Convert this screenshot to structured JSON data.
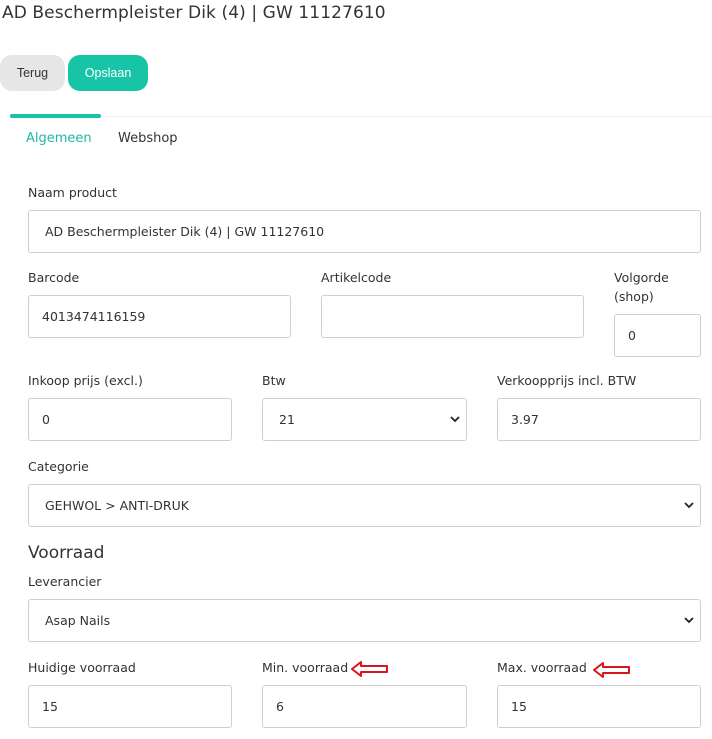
{
  "title": "AD Beschermpleister Dik (4) | GW 11127610",
  "buttons": {
    "back": "Terug",
    "save": "Opslaan"
  },
  "tabs": {
    "general": "Algemeen",
    "webshop": "Webshop"
  },
  "product": {
    "name_label": "Naam product",
    "name_value": "AD Beschermpleister Dik (4) | GW 11127610",
    "barcode_label": "Barcode",
    "barcode_value": "4013474116159",
    "article_label": "Artikelcode",
    "article_value": "",
    "order_label_1": "Volgorde",
    "order_label_2": "(shop)",
    "order_value": "0",
    "purchase_label": "Inkoop prijs (excl.)",
    "purchase_value": "0",
    "vat_label": "Btw",
    "vat_value": "21",
    "sale_label": "Verkoopprijs incl. BTW",
    "sale_value": "3.97",
    "category_label": "Categorie",
    "category_value": "GEHWOL > ANTI-DRUK"
  },
  "stock": {
    "section_title": "Voorraad",
    "supplier_label": "Leverancier",
    "supplier_value": "Asap Nails",
    "current_label": "Huidige voorraad",
    "current_value": "15",
    "min_label": "Min. voorraad",
    "min_value": "6",
    "max_label": "Max. voorraad",
    "max_value": "15"
  },
  "colors": {
    "accent": "#18c4a6",
    "annotation": "#d9161b"
  }
}
